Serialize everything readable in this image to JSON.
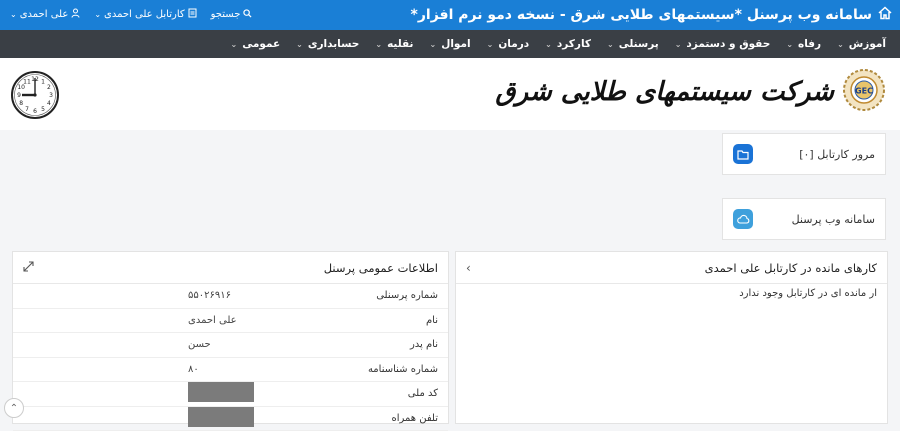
{
  "topbar": {
    "title": "سامانه وب پرسنل *سیستمهای طلایی شرق - نسخه دمو نرم افزار*",
    "links": [
      {
        "label": "جستجو",
        "icon": "search-icon"
      },
      {
        "label": "کارتابل علی احمدی",
        "icon": "document-icon"
      },
      {
        "label": "علی احمدی",
        "icon": "user-icon"
      }
    ]
  },
  "menu": {
    "items": [
      "آموزش",
      "رفاه",
      "حقوق و دستمزد",
      "پرسنلی",
      "کارکرد",
      "درمان",
      "اموال",
      "نقلیه",
      "حسابداری",
      "عمومی"
    ]
  },
  "header": {
    "brand": "شرکت سیستمهای طلایی شرق",
    "logo_text": "GEC"
  },
  "tiles": [
    {
      "label": "مرور کارتابل [۰]",
      "icon": "folder-icon",
      "color": "#1a73d6"
    },
    {
      "label": "سامانه وب پرسنل",
      "icon": "cloud-icon",
      "color": "#3ea0dc"
    }
  ],
  "tasks_panel": {
    "title": "کارهای مانده در کارتابل علی احمدی",
    "empty_message": "ار مانده ای در کارتابل وجود ندارد"
  },
  "info_panel": {
    "title": "اطلاعات عمومی پرسنل",
    "rows": [
      {
        "label": "شماره پرسنلی",
        "value": "۵۵۰۲۶۹۱۶"
      },
      {
        "label": "نام",
        "value": "علی احمدی"
      },
      {
        "label": "نام پدر",
        "value": "حسن"
      },
      {
        "label": "شماره شناسنامه",
        "value": "۸۰"
      },
      {
        "label": "کد ملی",
        "value": ""
      },
      {
        "label": "تلفن همراه",
        "value": ""
      }
    ]
  },
  "clock": {
    "numbers": [
      "12",
      "1",
      "2",
      "3",
      "4",
      "5",
      "6",
      "7",
      "8",
      "9",
      "10",
      "11"
    ]
  },
  "colors": {
    "topbar": "#1a7fd6",
    "menubar": "#3a3f45"
  }
}
